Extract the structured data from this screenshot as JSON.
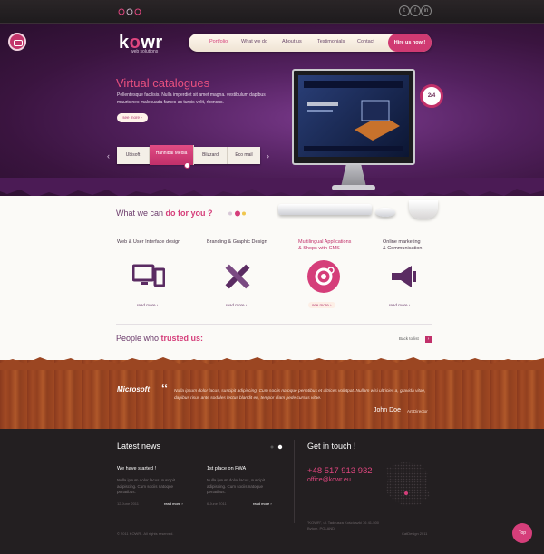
{
  "top_social": [
    "t",
    "f",
    "in"
  ],
  "brand": {
    "logo_pre": "k",
    "logo_o": "o",
    "logo_post": "wr",
    "tagline": "web solutions"
  },
  "nav": {
    "items": [
      "Portfolio",
      "What we do",
      "About us",
      "Testimonials",
      "Contact"
    ],
    "active": "Portfolio",
    "cta": "Hire us now !"
  },
  "hero": {
    "title": "Virtual catalogues",
    "text": "Pellentesque facilisis. Nulla imperdiet sit amet magna. vestibulum dapibus mauris nec malesuada fames ac turpis velit, rhoncus.",
    "see_more": "see more ›",
    "tabs": [
      "Ubisoft",
      "Hannibal Media",
      "Blizzard",
      "Eco mail"
    ],
    "active_tab": "Hannibal Media",
    "slide_indicator": "2/4",
    "prev": "‹",
    "next": "›"
  },
  "services": {
    "heading_pre": "What we can ",
    "heading_hl": "do for you ?",
    "items": [
      {
        "title_l1": "Web & User Interface design",
        "title_l2": "",
        "icon": "devices-icon",
        "more": "read more ›"
      },
      {
        "title_l1": "Branding & Graphic Design",
        "title_l2": "",
        "icon": "pencil-ruler-icon",
        "more": "read more ›"
      },
      {
        "title_l1": "Multilingual Applications",
        "title_l2": "& Shops with CMS",
        "icon": "gear-icon",
        "more": "see more ›"
      },
      {
        "title_l1": "Online marketing",
        "title_l2": "& Communication",
        "icon": "megaphone-icon",
        "more": "read more ›"
      }
    ]
  },
  "clients": {
    "heading_pre": "People who ",
    "heading_hl": "trusted us:",
    "back": "Back to list",
    "back_btn": "›"
  },
  "testimonial": {
    "company": "Microsoft",
    "quote_mark": "“",
    "text": "Nulla ipsum dolor lacus, suscipit adipiscing. Cum sociis natoque penatibus et ultrices volutpat. Nullam wisi ultricies a, gravida vitae, dapibus risus ante sodales lectus blandit eu, tempor diam pede cursus vitae.",
    "author": "John Doe",
    "role": "Art Director"
  },
  "footer": {
    "news_title": "Latest news",
    "news": [
      {
        "title": "We have started !",
        "text": "Nulla ipsum dolor lacus, suscipit adipiscing. Cum sociis natoque penatibus.",
        "date": "12 June 2011",
        "more": "read more ›"
      },
      {
        "title": "1st place on FWA",
        "text": "Nulla ipsum dolor lacus, suscipit adipiscing. Cum sociis natoque penatibus.",
        "date": "6 June 2011",
        "more": "read more ›"
      }
    ],
    "contact_title": "Get in touch !",
    "phone": "+48 517 913 932",
    "email": "office@kowr.eu",
    "address": "\"KOWR\", ul. Tadeusza Kościuszki 76 41-500 Bytom, POLAND",
    "copyright": "© 2011 KOWR . All rights reserved.",
    "credit": "CatDesign 2011",
    "top_btn": "Top"
  },
  "colors": {
    "accent": "#d53e7a",
    "purple": "#53215f",
    "wood": "#9b4622",
    "footer": "#231f21"
  }
}
